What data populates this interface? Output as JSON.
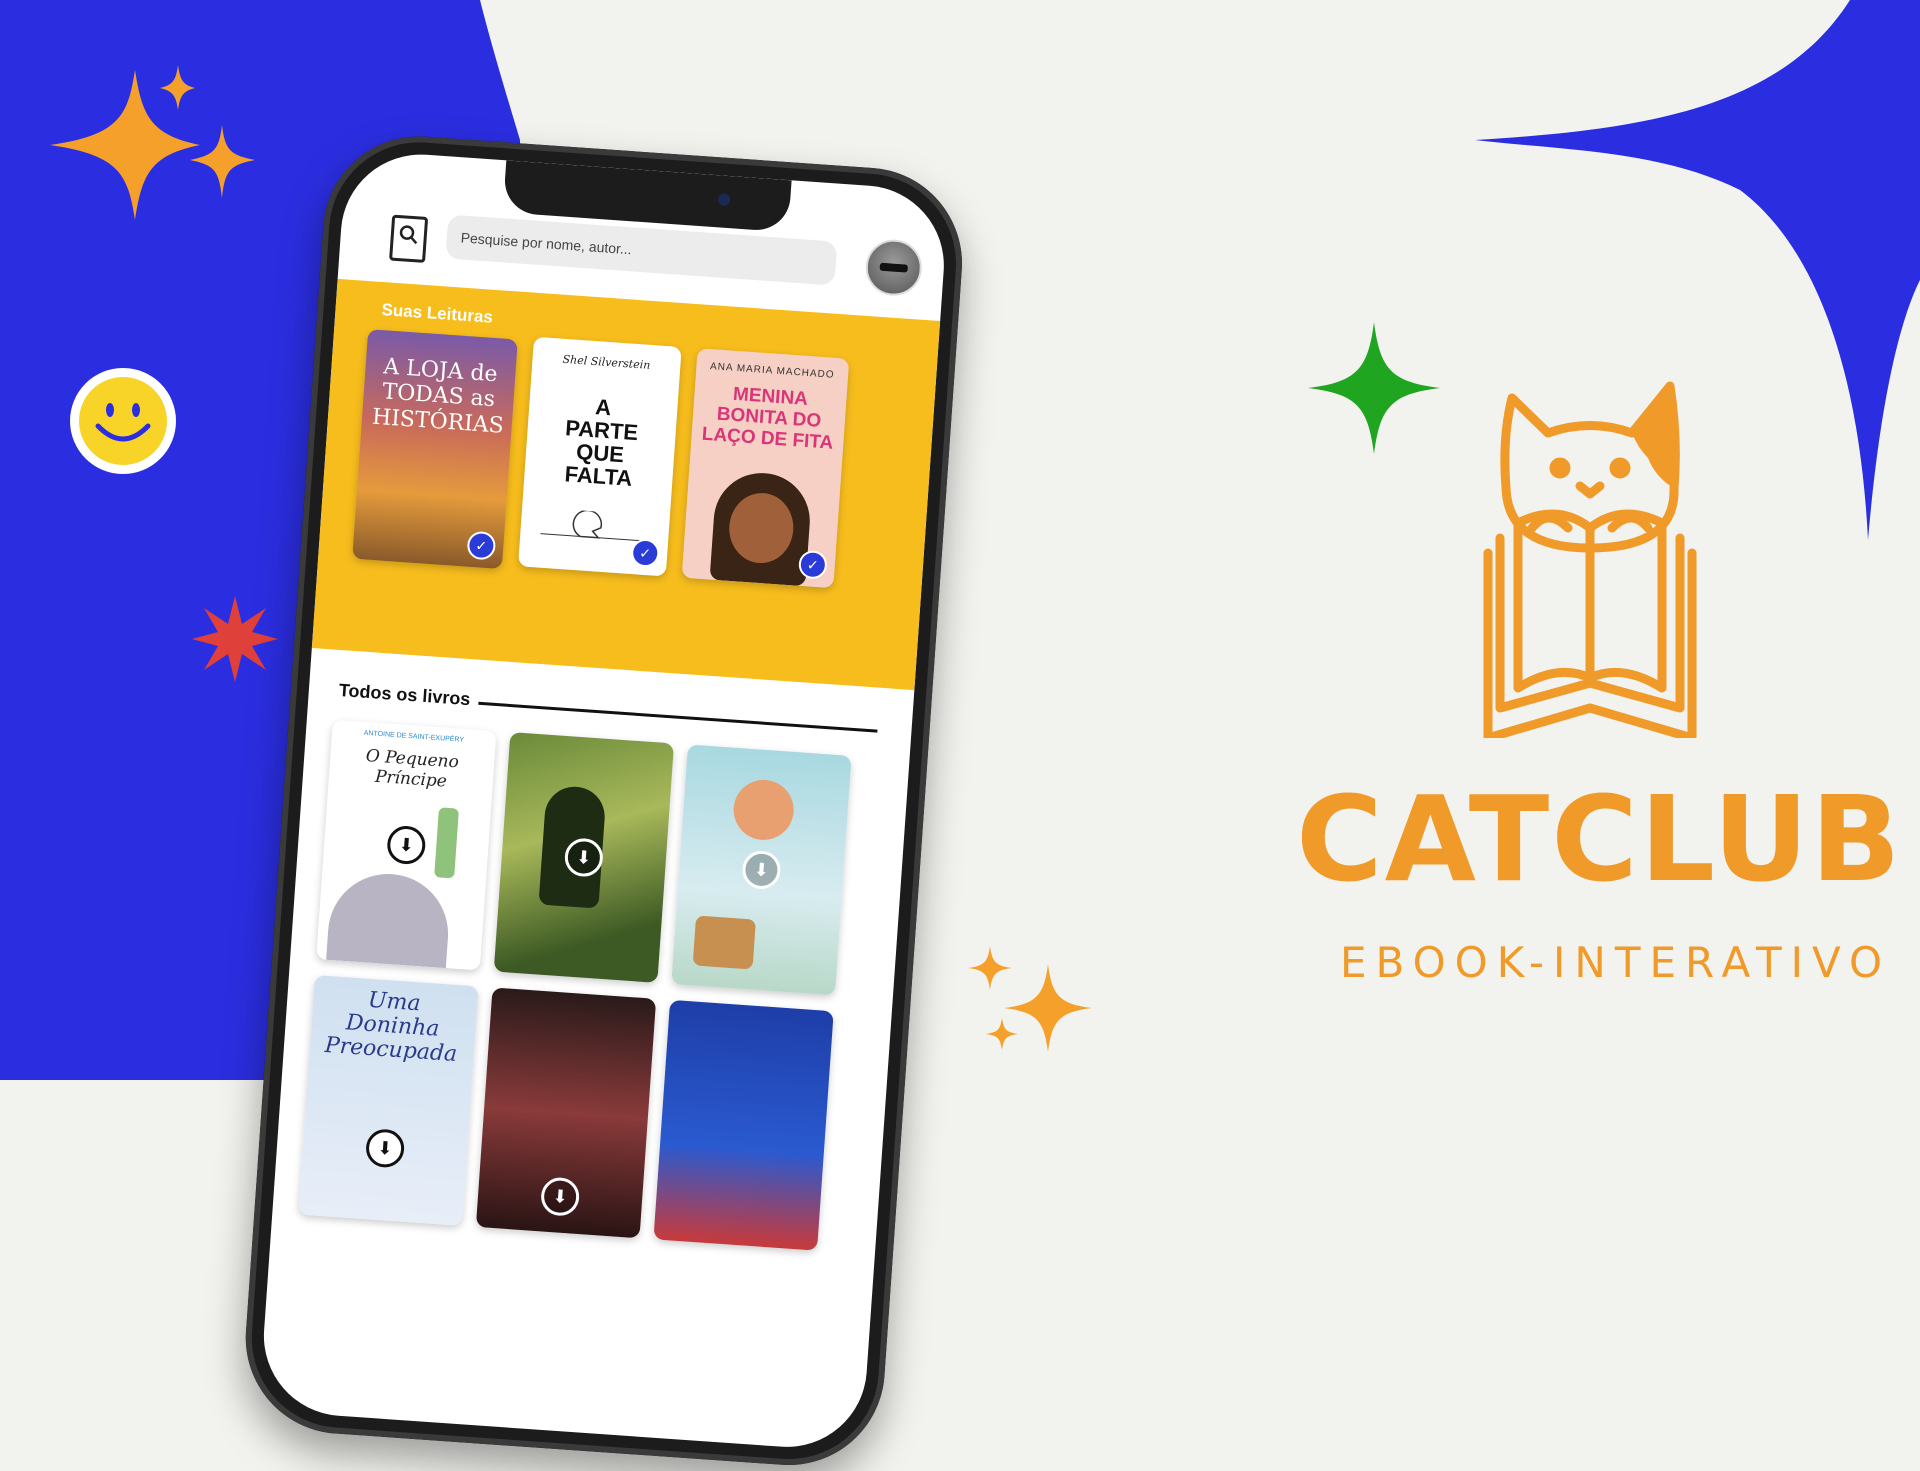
{
  "app": {
    "search": {
      "placeholder": "Pesquise por nome, autor..."
    },
    "section_reading": "Suas Leituras",
    "section_all": "Todos os livros",
    "reading_books": [
      {
        "title": "A LOJA de TODAS as HISTÓRIAS",
        "status": "check"
      },
      {
        "author": "Shel Silverstein",
        "title": "A PARTE QUE FALTA",
        "status": "check"
      },
      {
        "author": "ANA MARIA MACHADO",
        "title": "MENINA BONITA DO LAÇO DE FITA",
        "status": "check"
      }
    ],
    "all_books": [
      {
        "author": "ANTOINE DE SAINT-EXUPÉRY",
        "title": "O Pequeno Príncipe"
      },
      {
        "title": ""
      },
      {
        "title": ""
      },
      {
        "title": "Uma Doninha Preocupada"
      },
      {
        "title": ""
      },
      {
        "title": ""
      }
    ]
  },
  "brand": {
    "name": "CATCLUB",
    "tagline": "EBOOK-INTERATIVO",
    "color": "#f09a2a"
  },
  "colors": {
    "blue": "#2b2ee0",
    "yellow": "#f7bd1d",
    "orange": "#f09a2a",
    "green": "#1fa51f",
    "red": "#e0403a",
    "background": "#f2f2ee"
  },
  "icons": [
    "search-icon",
    "sparkle-icon",
    "smiley-icon",
    "starburst-icon",
    "check-icon",
    "download-icon",
    "cat-book-logo-icon"
  ]
}
